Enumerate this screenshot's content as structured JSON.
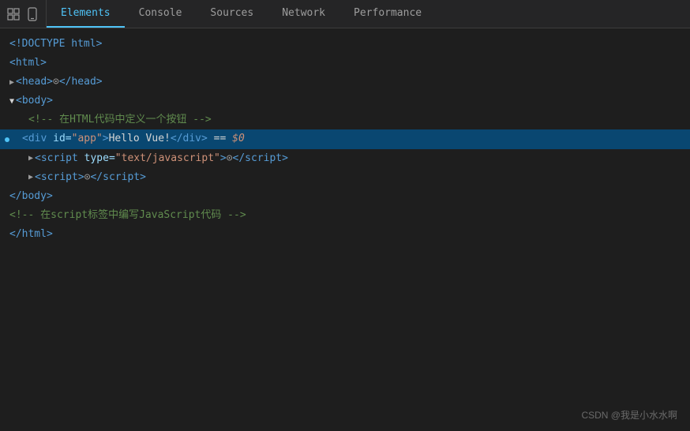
{
  "toolbar": {
    "tabs": [
      {
        "id": "elements",
        "label": "Elements",
        "active": true
      },
      {
        "id": "console",
        "label": "Console",
        "active": false
      },
      {
        "id": "sources",
        "label": "Sources",
        "active": false
      },
      {
        "id": "network",
        "label": "Network",
        "active": false
      },
      {
        "id": "performance",
        "label": "Performance",
        "active": false
      }
    ]
  },
  "lines": [
    {
      "id": 1,
      "indent": 0,
      "selected": false,
      "type": "doctype",
      "text": "<!DOCTYPE html>"
    },
    {
      "id": 2,
      "indent": 0,
      "selected": false,
      "type": "tag-open",
      "text": "<html>"
    },
    {
      "id": 3,
      "indent": 0,
      "selected": false,
      "type": "head-collapsed",
      "text": "▶ <head>…</head>"
    },
    {
      "id": 4,
      "indent": 0,
      "selected": false,
      "type": "body-open",
      "text": "▼ <body>"
    },
    {
      "id": 5,
      "indent": 2,
      "selected": false,
      "type": "comment",
      "text": "<!-- 在HTML代码中定义一个按钮 -->"
    },
    {
      "id": 6,
      "indent": 2,
      "selected": true,
      "type": "div-selected",
      "text": ""
    },
    {
      "id": 7,
      "indent": 2,
      "selected": false,
      "type": "script1",
      "text": ""
    },
    {
      "id": 8,
      "indent": 2,
      "selected": false,
      "type": "script2",
      "text": ""
    },
    {
      "id": 9,
      "indent": 0,
      "selected": false,
      "type": "body-close",
      "text": "</body>"
    },
    {
      "id": 10,
      "indent": 0,
      "selected": false,
      "type": "comment2",
      "text": "<!-- 在script标签中编写JavaScript代码 -->"
    },
    {
      "id": 11,
      "indent": 0,
      "selected": false,
      "type": "html-close",
      "text": "</html>"
    }
  ],
  "watermark": "CSDN @我是小水水啊"
}
